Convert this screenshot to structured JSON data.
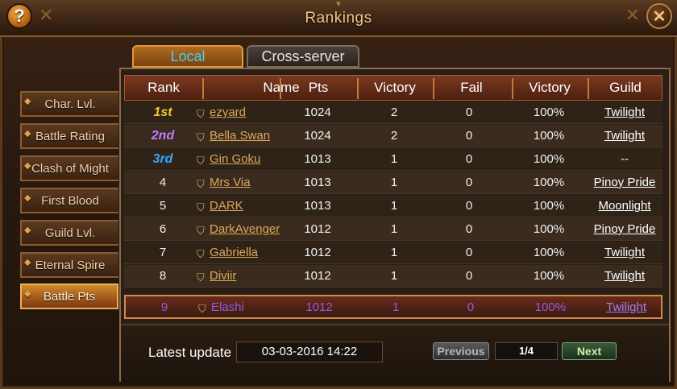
{
  "window": {
    "title": "Rankings"
  },
  "tabs": [
    {
      "label": "Local",
      "active": true
    },
    {
      "label": "Cross-server",
      "active": false
    }
  ],
  "sidebar": {
    "items": [
      {
        "label": "Char. Lvl.",
        "active": false
      },
      {
        "label": "Battle Rating",
        "active": false
      },
      {
        "label": "Clash of Might",
        "active": false
      },
      {
        "label": "First Blood",
        "active": false
      },
      {
        "label": "Guild Lvl.",
        "active": false
      },
      {
        "label": "Eternal Spire",
        "active": false
      },
      {
        "label": "Battle Pts",
        "active": true
      }
    ]
  },
  "table": {
    "headers": [
      "Rank",
      "Name",
      "Pts",
      "Victory",
      "Fail",
      "Victory",
      "Guild"
    ],
    "rows": [
      {
        "rank": "1st",
        "name": "ezyard",
        "pts": "1024",
        "victory": "2",
        "fail": "0",
        "rate": "100%",
        "guild": "Twilight"
      },
      {
        "rank": "2nd",
        "name": "Bella Swan",
        "pts": "1024",
        "victory": "2",
        "fail": "0",
        "rate": "100%",
        "guild": "Twilight"
      },
      {
        "rank": "3rd",
        "name": "Gin Goku",
        "pts": "1013",
        "victory": "1",
        "fail": "0",
        "rate": "100%",
        "guild": "--"
      },
      {
        "rank": "4",
        "name": "Mrs Via",
        "pts": "1013",
        "victory": "1",
        "fail": "0",
        "rate": "100%",
        "guild": "Pinoy Pride"
      },
      {
        "rank": "5",
        "name": "DARK",
        "pts": "1013",
        "victory": "1",
        "fail": "0",
        "rate": "100%",
        "guild": "Moonlight"
      },
      {
        "rank": "6",
        "name": "DarkAvenger",
        "pts": "1012",
        "victory": "1",
        "fail": "0",
        "rate": "100%",
        "guild": "Pinoy Pride"
      },
      {
        "rank": "7",
        "name": "Gabriella",
        "pts": "1012",
        "victory": "1",
        "fail": "0",
        "rate": "100%",
        "guild": "Twilight"
      },
      {
        "rank": "8",
        "name": "Diviir",
        "pts": "1012",
        "victory": "1",
        "fail": "0",
        "rate": "100%",
        "guild": "Twilight"
      }
    ],
    "self": {
      "rank": "9",
      "name": "Elashi",
      "pts": "1012",
      "victory": "1",
      "fail": "0",
      "rate": "100%",
      "guild": "Twilight"
    }
  },
  "footer": {
    "update_label": "Latest update",
    "update_value": "03-03-2016 14:22",
    "prev_label": "Previous",
    "page": "1/4",
    "next_label": "Next"
  },
  "colors": {
    "rank1": "#f5c531",
    "rank2": "#c27bff",
    "rank3": "#35a8ff",
    "accent": "#d08a2c"
  },
  "icons": [
    "help-icon",
    "close-icon",
    "guild-shield-icon"
  ]
}
